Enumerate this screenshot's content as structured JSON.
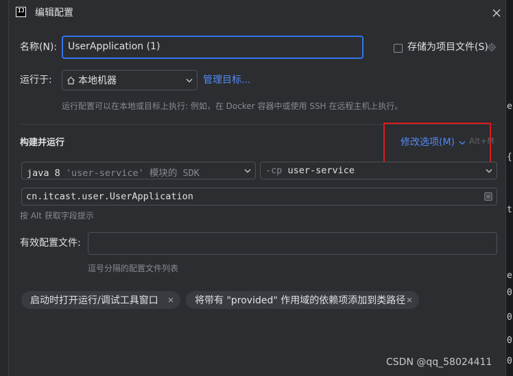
{
  "window": {
    "title": "编辑配置"
  },
  "name_field": {
    "label": "名称(N):",
    "value": "UserApplication (1)"
  },
  "store_as_file": {
    "label": "存储为项目文件(S)"
  },
  "run_on": {
    "label": "运行于:",
    "selected": "本地机器",
    "manage_link": "管理目标...",
    "hint": "运行配置可以在本地或目标上执行: 例如，在 Docker 容器中或使用 SSH 在远程主机上执行。"
  },
  "build_run": {
    "heading": "构建并运行",
    "modify_options": "修改选项(M)",
    "shortcut": "Alt+M",
    "sdk_prefix": "java 8",
    "sdk_detail": "'user-service' 模块的 SDK",
    "cp_flag": "-cp",
    "cp_value": "user-service",
    "main_class": "cn.itcast.user.UserApplication",
    "field_hint": "按 Alt 获取字段提示"
  },
  "profiles": {
    "label": "有效配置文件:",
    "value": "",
    "hint": "逗号分隔的配置文件列表"
  },
  "chips": [
    {
      "label": "启动时打开运行/调试工具窗口"
    },
    {
      "label": "将带有 \"provided\" 作用域的依赖项添加到类路径"
    }
  ],
  "watermark": "CSDN @qq_58024411",
  "background_glyphs": [
    "e",
    "{",
    "t",
    "e",
    "0",
    "0",
    "0",
    "0"
  ],
  "colors": {
    "accent": "#3574f0",
    "link": "#548af7",
    "highlight": "#e0191b",
    "dialog_bg": "#2b2d30"
  }
}
